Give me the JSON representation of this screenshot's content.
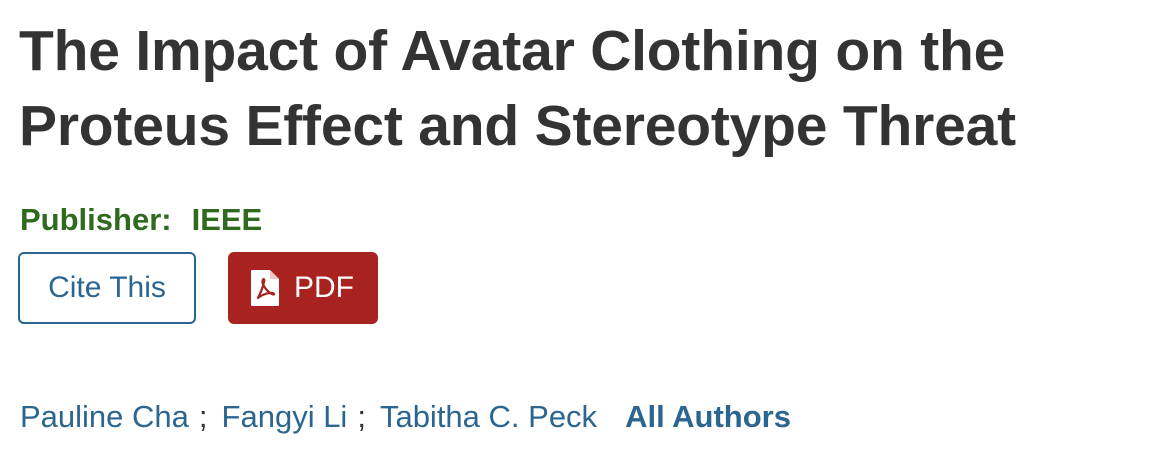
{
  "document": {
    "title_line1": "The Impact of Avatar Clothing on the",
    "title_line2": "Proteus Effect and Stereotype Threat",
    "publisher_label": "Publisher:",
    "publisher_name": "IEEE"
  },
  "actions": {
    "cite_label": "Cite This",
    "pdf_label": "PDF",
    "pdf_icon": "pdf-file-icon"
  },
  "authors": {
    "list": [
      "Pauline Cha",
      "Fangyi Li",
      "Tabitha C. Peck"
    ],
    "separator": ";",
    "all_authors_label": "All Authors"
  },
  "colors": {
    "title": "#333333",
    "publisher": "#2e6b1f",
    "link": "#2b6690",
    "pdf_button": "#a8231f"
  }
}
